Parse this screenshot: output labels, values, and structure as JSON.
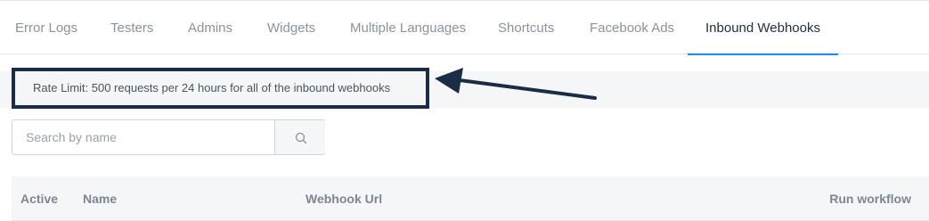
{
  "tabs": [
    {
      "label": "Error Logs",
      "active": false
    },
    {
      "label": "Testers",
      "active": false
    },
    {
      "label": "Admins",
      "active": false
    },
    {
      "label": "Widgets",
      "active": false
    },
    {
      "label": "Multiple Languages",
      "active": false
    },
    {
      "label": "Shortcuts",
      "active": false
    },
    {
      "label": "Facebook Ads",
      "active": false
    },
    {
      "label": "Inbound Webhooks",
      "active": true
    }
  ],
  "notice": {
    "text": "Rate Limit: 500 requests per 24 hours for all of the inbound webhooks"
  },
  "search": {
    "placeholder": "Search by name",
    "value": "",
    "icon": "search-icon"
  },
  "table": {
    "columns": [
      "Active",
      "Name",
      "Webhook Url",
      "Run workflow"
    ]
  },
  "colors": {
    "accent": "#188bf6",
    "annotation": "#1b2d44",
    "tab_text": "#8a939c",
    "tab_active_text": "#24303c"
  }
}
